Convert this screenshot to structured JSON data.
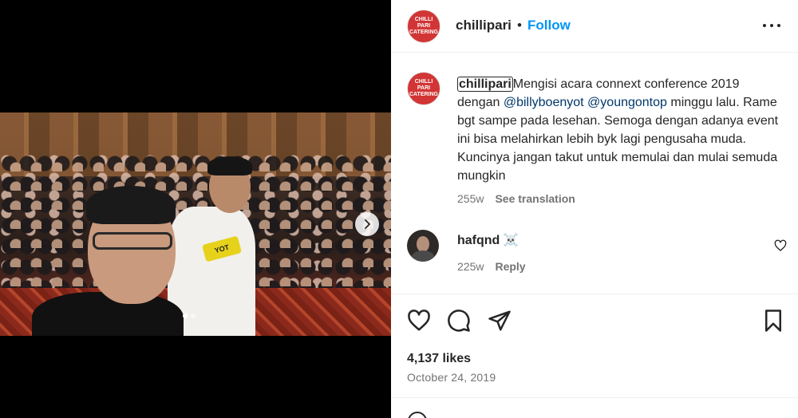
{
  "post": {
    "username": "chillipari",
    "avatar_text": "CHILLI PARI CATERING",
    "follow_label": "Follow",
    "separator": "•",
    "caption": {
      "username": "chillipari",
      "text_1": "Mengisi acara connext conference 2019 dengan ",
      "mention_1": "@billyboenyot",
      "text_2": " ",
      "mention_2": "@youngontop",
      "text_3": " minggu lalu. Rame bgt sampe pada lesehan. Semoga dengan adanya event ini bisa melahirkan lebih byk lagi pengusaha muda. Kuncinya jangan takut untuk memulai dan mulai semuda mungkin",
      "age": "255w",
      "translate_label": "See translation"
    },
    "comment": {
      "username": "hafqnd",
      "text": "☠️",
      "age": "225w",
      "reply_label": "Reply"
    },
    "likes": "4,137 likes",
    "date": "October 24, 2019",
    "photo_mic_label": "YOT",
    "carousel": {
      "count": 2,
      "active": 1
    }
  },
  "icons": {
    "like": "heart-icon",
    "comment": "comment-icon",
    "share": "send-icon",
    "save": "bookmark-icon",
    "more": "more-horizontal-icon",
    "next": "chevron-right-icon"
  },
  "colors": {
    "follow": "#0095f6",
    "mention": "#00376b",
    "secondary_text": "#737373",
    "brand_red": "#d23535"
  }
}
